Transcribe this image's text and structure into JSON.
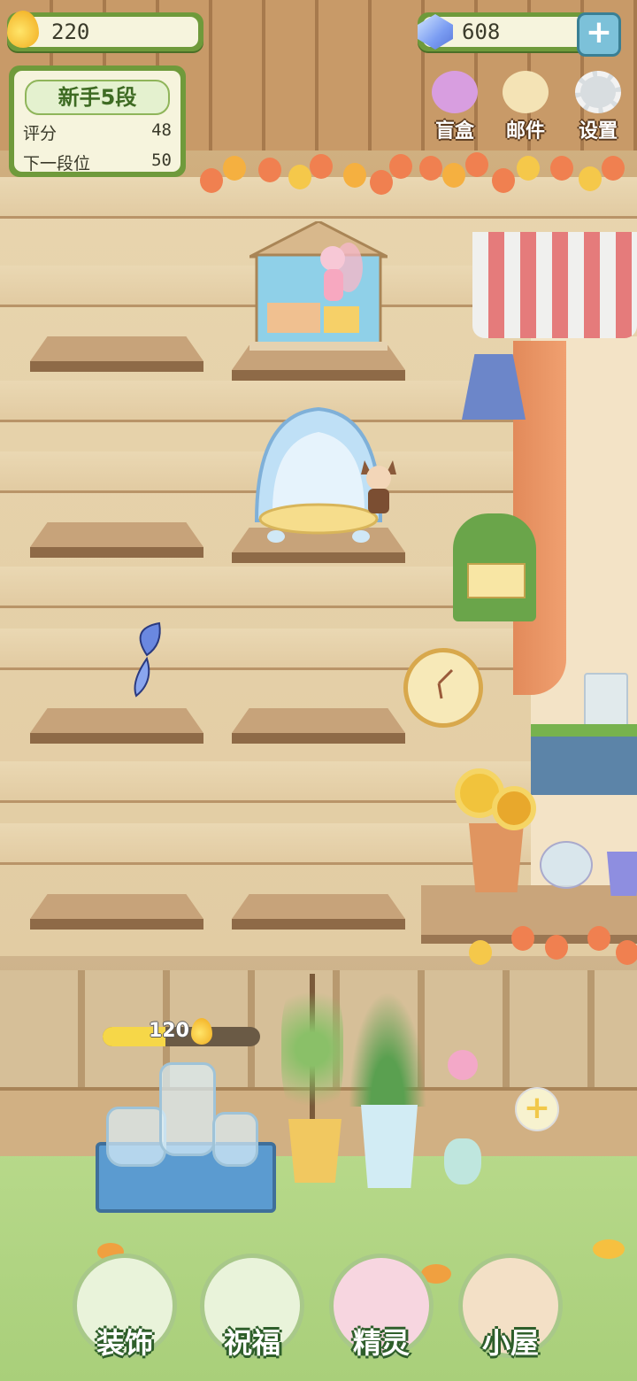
{
  "hud": {
    "drops": "220",
    "gems": "608",
    "add_label": "+"
  },
  "rank": {
    "title": "新手5段",
    "score_label": "评分",
    "score_value": "48",
    "next_label": "下一段位",
    "next_value": "50"
  },
  "top_menu": [
    {
      "label": "盲盒",
      "icon": "blind-box-icon",
      "color": "#d89ee0"
    },
    {
      "label": "邮件",
      "icon": "mail-icon",
      "color": "#f4e3b5"
    },
    {
      "label": "设置",
      "icon": "gear-icon",
      "color": "#d8dde0"
    }
  ],
  "energy": {
    "value": "120",
    "fill": 0.4
  },
  "add_button": "+",
  "bottom_nav": [
    {
      "label": "装饰",
      "icon": "plant-decor-icon"
    },
    {
      "label": "祝福",
      "icon": "butterfly-blessing-icon"
    },
    {
      "label": "精灵",
      "icon": "fairy-icon"
    },
    {
      "label": "小屋",
      "icon": "house-icon"
    }
  ]
}
